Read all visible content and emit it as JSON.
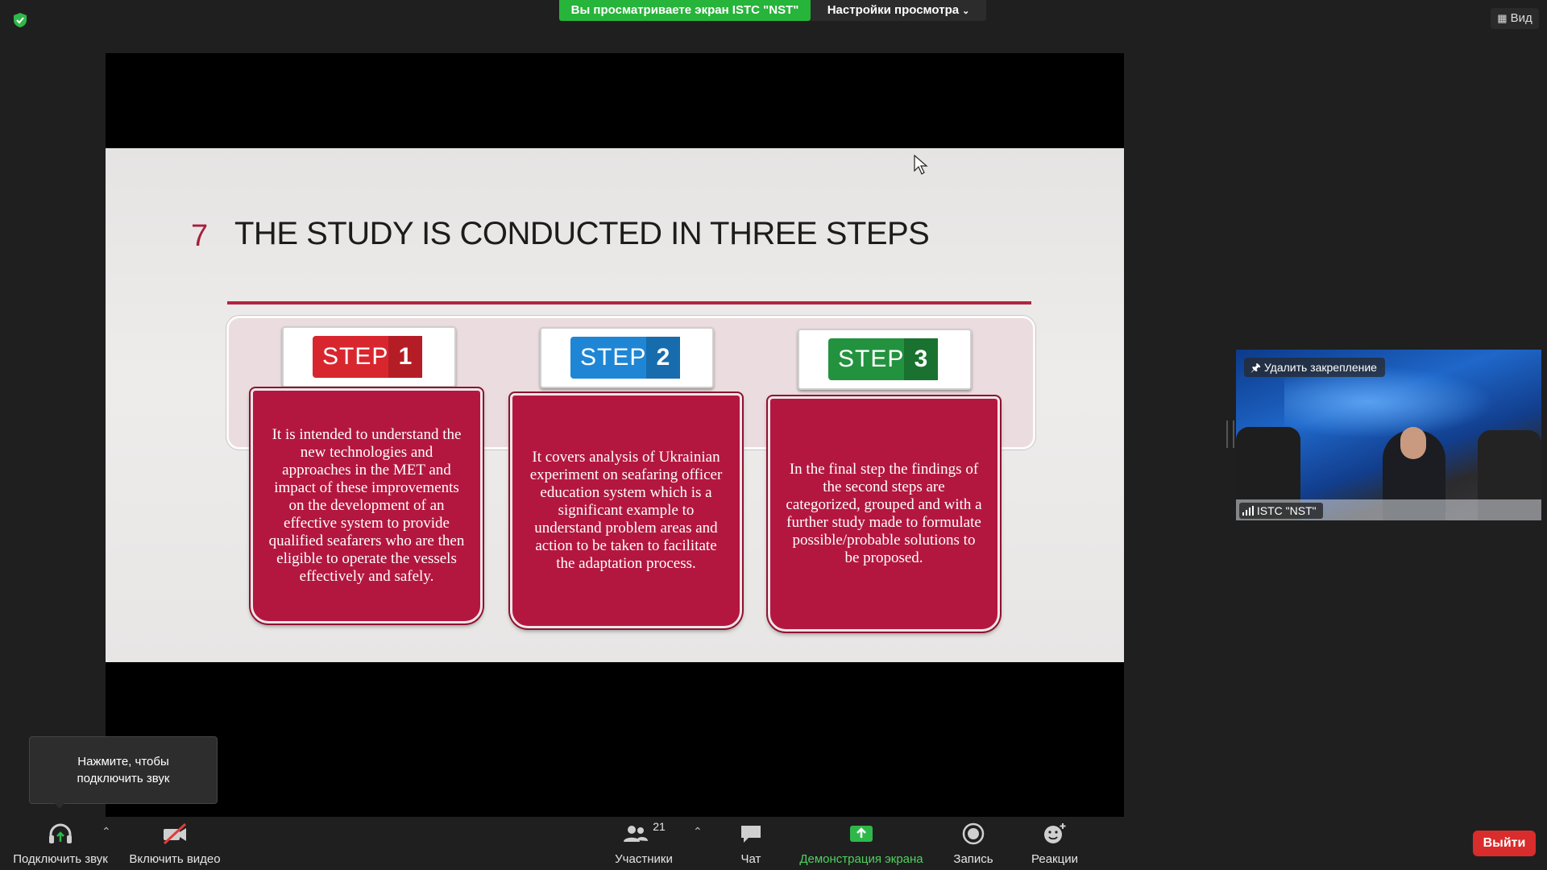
{
  "top_bar": {
    "banner_text": "Вы просматриваете экран ISTC \"NST\"",
    "view_options_label": "Настройки просмотра",
    "view_button_label": "Вид"
  },
  "slide": {
    "number": "7",
    "title": "THE STUDY IS CONDUCTED IN THREE STEPS",
    "steps": [
      {
        "word": "STEP",
        "num": "1",
        "color": "#d8262f",
        "text": "It is intended to understand the new technologies and approaches in the MET and impact of these improvements on the development of an effective system to provide qualified seafarers who are then eligible to operate the vessels effectively and safely."
      },
      {
        "word": "STEP",
        "num": "2",
        "color": "#1f7fce",
        "text": "It covers analysis of Ukrainian experiment on seafaring officer education system which is a significant example to understand problem areas and action to be taken to facilitate the adaptation process."
      },
      {
        "word": "STEP",
        "num": "3",
        "color": "#1f8a3c",
        "text": "In the final step the findings of the second steps are categorized, grouped and with a further study made to formulate possible/probable solutions to be proposed."
      }
    ]
  },
  "participant_tile": {
    "unpin_label": "Удалить закрепление",
    "name": "ISTC \"NST\""
  },
  "tooltip": {
    "line1": "Нажмите, чтобы",
    "line2": "подключить звук"
  },
  "toolbar": {
    "audio_label": "Подключить звук",
    "video_label": "Включить видео",
    "participants_label": "Участники",
    "participants_count": "21",
    "chat_label": "Чат",
    "share_label": "Демонстрация экрана",
    "record_label": "Запись",
    "reactions_label": "Реакции",
    "exit_label": "Выйти"
  },
  "colors": {
    "share_green": "#27b43a",
    "exit_red": "#d92c2c",
    "slide_accent": "#b3173f"
  }
}
